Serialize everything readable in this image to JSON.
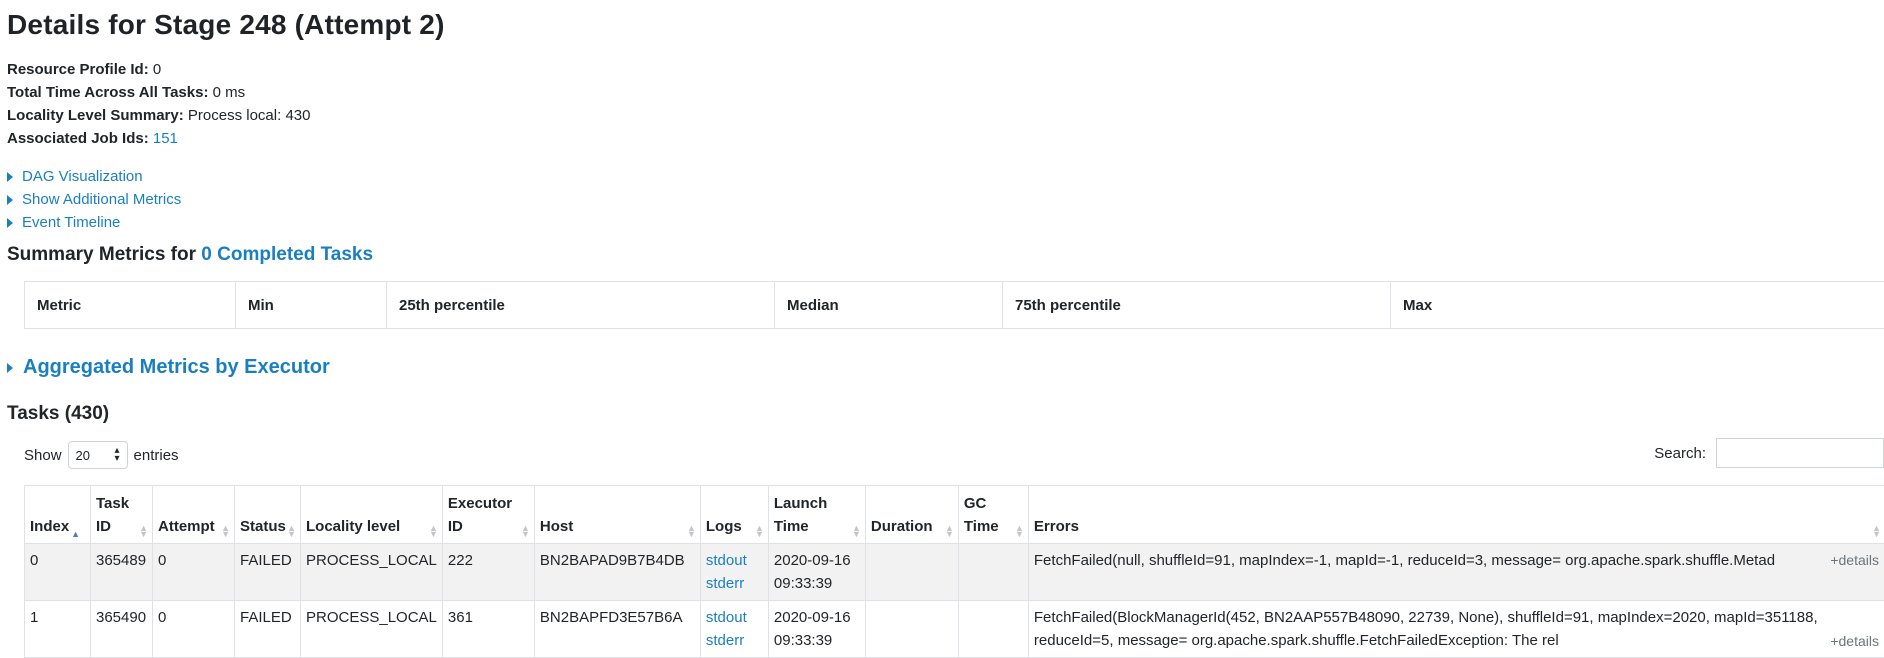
{
  "page_title": "Details for Stage 248 (Attempt 2)",
  "summary": {
    "resource_profile_label": "Resource Profile Id:",
    "resource_profile_value": "0",
    "total_time_label": "Total Time Across All Tasks:",
    "total_time_value": "0 ms",
    "locality_label": "Locality Level Summary:",
    "locality_value": "Process local: 430",
    "job_ids_label": "Associated Job Ids:",
    "job_ids_value": "151"
  },
  "toggles": {
    "dag": "DAG Visualization",
    "additional_metrics": "Show Additional Metrics",
    "event_timeline": "Event Timeline"
  },
  "summary_metrics": {
    "prefix": "Summary Metrics for ",
    "link": "0 Completed Tasks",
    "headers": [
      "Metric",
      "Min",
      "25th percentile",
      "Median",
      "75th percentile",
      "Max"
    ]
  },
  "aggregated": "Aggregated Metrics by Executor",
  "tasks_heading": "Tasks (430)",
  "controls": {
    "show_label": "Show",
    "page_size": "20",
    "entries_label": "entries",
    "search_label": "Search:"
  },
  "tasks_table": {
    "headers": {
      "index": "Index",
      "task_id_1": "Task",
      "task_id_2": "ID",
      "attempt": "Attempt",
      "status": "Status",
      "locality": "Locality level",
      "executor_1": "Executor",
      "executor_2": "ID",
      "host": "Host",
      "logs": "Logs",
      "launch_1": "Launch",
      "launch_2": "Time",
      "duration": "Duration",
      "gc_1": "GC",
      "gc_2": "Time",
      "errors": "Errors"
    },
    "rows": [
      {
        "index": "0",
        "task_id": "365489",
        "attempt": "0",
        "status": "FAILED",
        "locality": "PROCESS_LOCAL",
        "executor": "222",
        "host": "BN2BAPAD9B7B4DB",
        "log_stdout": "stdout",
        "log_stderr": "stderr",
        "launch_date": "2020-09-16",
        "launch_time": "09:33:39",
        "duration": "",
        "gc_time": "",
        "error": "FetchFailed(null, shuffleId=91, mapIndex=-1, mapId=-1, reduceId=3, message= org.apache.spark.shuffle.Metad",
        "details": "+details"
      },
      {
        "index": "1",
        "task_id": "365490",
        "attempt": "0",
        "status": "FAILED",
        "locality": "PROCESS_LOCAL",
        "executor": "361",
        "host": "BN2BAPFD3E57B6A",
        "log_stdout": "stdout",
        "log_stderr": "stderr",
        "launch_date": "2020-09-16",
        "launch_time": "09:33:39",
        "duration": "",
        "gc_time": "",
        "error": "FetchFailed(BlockManagerId(452, BN2AAP557B48090, 22739, None), shuffleId=91, mapIndex=2020, mapId=351188, reduceId=5, message= org.apache.spark.shuffle.FetchFailedException: The rel",
        "details": "+details"
      }
    ]
  }
}
